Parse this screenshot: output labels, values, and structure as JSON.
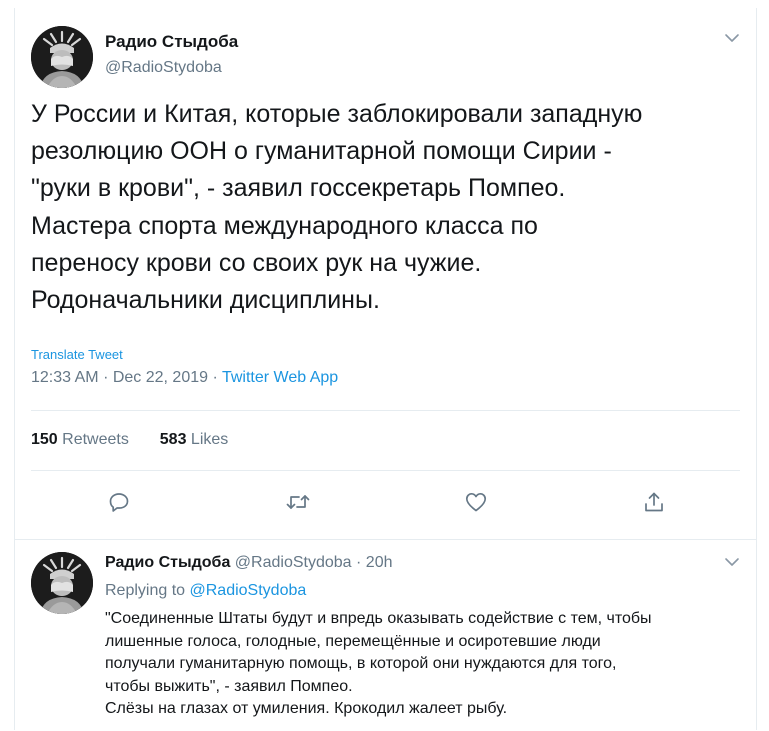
{
  "tweet": {
    "author_name": "Радио Стыдоба",
    "author_handle": "@RadioStydoba",
    "text": "У России и Китая, которые заблокировали западную\nрезолюцию ООН о гуманитарной помощи Сирии -\n\"руки в крови\", - заявил госсекретарь Помпео.\nМастера спорта международного класса по\nпереносу крови со своих рук на чужие.\nРодоначальники дисциплины.",
    "translate_label": "Translate Tweet",
    "time": "12:33 AM",
    "date": "Dec 22, 2019",
    "separator": "·",
    "source": "Twitter Web App",
    "retweets_count": "150",
    "retweets_label": "Retweets",
    "likes_count": "583",
    "likes_label": "Likes"
  },
  "actions": {
    "icons": [
      "reply-icon",
      "retweet-icon",
      "like-icon",
      "share-icon"
    ]
  },
  "reply": {
    "author_name": "Радио Стыдоба",
    "author_handle": "@RadioStydoba",
    "separator": "·",
    "time_ago": "20h",
    "replying_to_label": "Replying to",
    "replying_to_handle": "@RadioStydoba",
    "text": "\"Соединенные Штаты будут и впредь оказывать содействие с тем, чтобы\nлишенные голоса, голодные, перемещённые и осиротевшие люди\nполучали гуманитарную помощь, в которой они нуждаются для того,\nчтобы выжить\", - заявил Помпео.\nСлёзы на глазах от умиления. Крокодил жалеет рыбу."
  },
  "colors": {
    "text_primary": "#14171a",
    "text_secondary": "#657786",
    "link": "#1b95e0",
    "divider": "#e6ecf0"
  }
}
